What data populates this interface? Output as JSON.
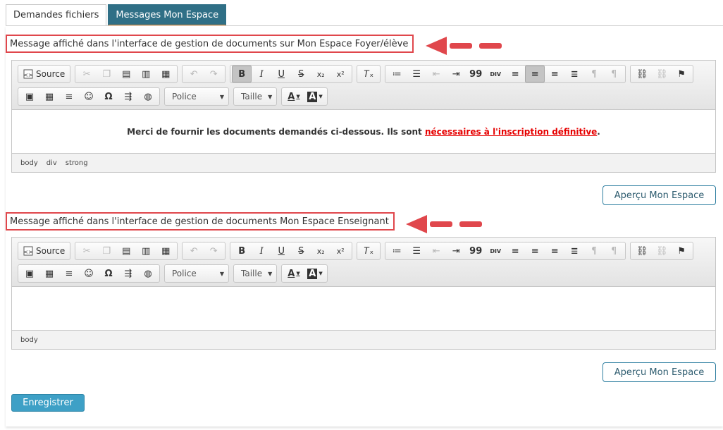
{
  "tabs": [
    {
      "label": "Demandes fichiers",
      "active": false
    },
    {
      "label": "Messages Mon Espace",
      "active": true
    }
  ],
  "editor1": {
    "label": "Message affiché dans l'interface de gestion de documents sur Mon Espace Foyer/élève",
    "content_text": "Merci de fournir les documents demandés ci-dessous. Ils sont ",
    "content_link": "nécessaires à l'inscription définitive",
    "content_end": ".",
    "path": [
      "body",
      "div",
      "strong"
    ],
    "preview_label": "Aperçu Mon Espace"
  },
  "editor2": {
    "label": "Message affiché dans l'interface de gestion de documents Mon Espace Enseignant",
    "path": [
      "body"
    ],
    "preview_label": "Aperçu Mon Espace"
  },
  "toolbar": {
    "source_label": "Source",
    "font_label": "Police",
    "size_label": "Taille",
    "bold": "B",
    "italic": "I",
    "underline": "U",
    "strike": "S",
    "subscript": "x₂",
    "superscript": "x²",
    "blockquote": "99",
    "div": "DIV",
    "omega": "Ω",
    "text_color": "A",
    "bg_color": "A"
  },
  "save_label": "Enregistrer",
  "colors": {
    "accent": "#2f6f86",
    "tab_underline": "#e5892f",
    "annotation": "#e0474c",
    "link": "#e60000",
    "save_bg": "#3ea0c6"
  }
}
